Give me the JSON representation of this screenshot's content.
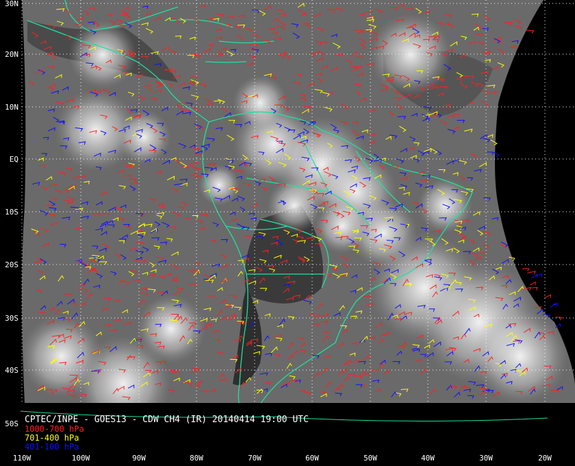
{
  "caption": {
    "title": "CPTEC/INPE - GOES13 - CDW CH4 (IR) 20140414 19:00 UTC",
    "title_color": "#ffffff"
  },
  "legend": [
    {
      "label": "1000-700 hPa",
      "color": "#ff2020"
    },
    {
      "label": "701-400 hPa",
      "color": "#ffff00"
    },
    {
      "label": "401-100 hPa",
      "color": "#1010ff"
    }
  ],
  "grid": {
    "latitude_labels": [
      "30N",
      "20N",
      "10N",
      "EQ",
      "10S",
      "20S",
      "30S",
      "40S",
      "50S"
    ],
    "longitude_labels": [
      "110W",
      "100W",
      "90W",
      "80W",
      "70W",
      "60W",
      "50W",
      "40W",
      "30W",
      "20W"
    ],
    "color": "#ffffff",
    "style": "dotted"
  },
  "colors": {
    "background": "#000000",
    "coastline": "#20e0a0",
    "cloud": "#ffffff"
  }
}
